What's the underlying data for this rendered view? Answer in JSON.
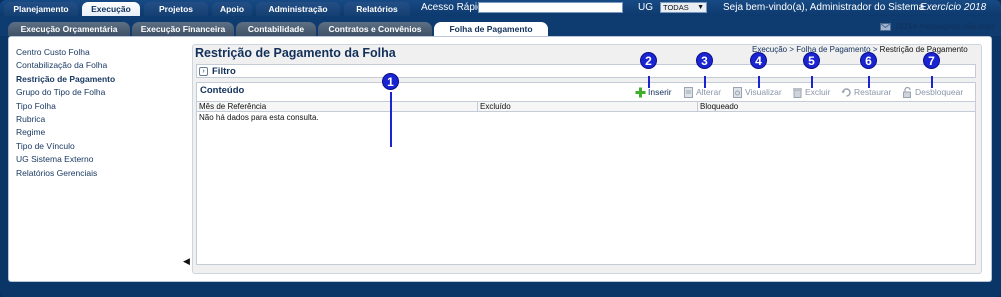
{
  "topbar": {
    "menu": [
      "Planejamento",
      "Execução",
      "Projetos",
      "Apoio",
      "Administração",
      "Relatórios"
    ],
    "active_menu": "Execução",
    "quick_access_label": "Acesso Rápido",
    "quick_access_value": "",
    "ug_label": "UG",
    "ug_value": "TODAS",
    "welcome": "Seja bem-vindo(a), Administrador do Sistema",
    "exercise": "Exercício 2018"
  },
  "subtabs": [
    "Execução Orçamentária",
    "Execução Financeira",
    "Contabilidade",
    "Contratos e Convênios",
    "Folha de Pagamento"
  ],
  "active_subtab": "Folha de Pagamento",
  "messages": "18194 mensagens não lidas",
  "sidebar": {
    "items": [
      "Centro Custo Folha",
      "Contabilização da Folha",
      "Restrição de Pagamento",
      "Grupo do Tipo de Folha",
      "Tipo Folha",
      "Rubrica",
      "Regime",
      "Tipo de Vínculo",
      "UG Sistema Externo",
      "Relatórios Gerenciais"
    ],
    "active": "Restrição de Pagamento"
  },
  "page": {
    "title": "Restrição de Pagamento da Folha",
    "breadcrumb": [
      "Execução",
      "Folha de Pagamento",
      "Restrição de Pagamento"
    ],
    "filter_label": "Filtro",
    "content_label": "Conteúdo"
  },
  "toolbar": [
    {
      "label": "Inserir",
      "icon": "plus-icon",
      "enabled": true
    },
    {
      "label": "Alterar",
      "icon": "edit-document-icon",
      "enabled": false
    },
    {
      "label": "Visualizar",
      "icon": "view-document-icon",
      "enabled": false
    },
    {
      "label": "Excluir",
      "icon": "trash-icon",
      "enabled": false
    },
    {
      "label": "Restaurar",
      "icon": "restore-icon",
      "enabled": false
    },
    {
      "label": "Desbloquear",
      "icon": "unlock-icon",
      "enabled": false
    }
  ],
  "table": {
    "columns": [
      "Mês de Referência",
      "Excluído",
      "Bloqueado"
    ],
    "empty_message": "Não há dados para esta consulta."
  },
  "markers": [
    "1",
    "2",
    "3",
    "4",
    "5",
    "6",
    "7"
  ],
  "colors": {
    "marker": "#1a24d0",
    "nav_bg": "#0d3a6e",
    "add_icon": "#3fae2a"
  }
}
